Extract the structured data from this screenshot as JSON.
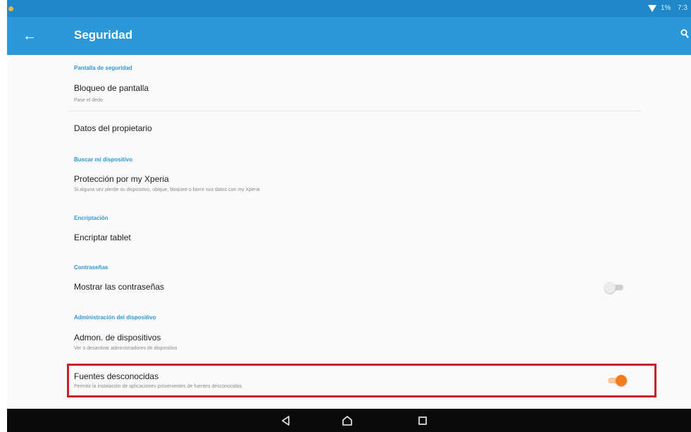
{
  "status_bar": {
    "battery_text": "1%",
    "time": "7:3"
  },
  "app_bar": {
    "title": "Seguridad"
  },
  "sections": {
    "screen_security": {
      "header": "Pantalla de seguridad",
      "lock": {
        "title": "Bloqueo de pantalla",
        "subtitle": "Pase el dedo"
      },
      "owner": {
        "title": "Datos del propietario"
      }
    },
    "find_device": {
      "header": "Buscar mi dispositivo",
      "xperia": {
        "title": "Protección por my Xperia",
        "subtitle": "Si alguna vez pierde su dispositivo, ubique, bloquee o borre sus datos con my Xperia"
      }
    },
    "encryption": {
      "header": "Encriptación",
      "encrypt": {
        "title": "Encriptar tablet"
      }
    },
    "passwords": {
      "header": "Contraseñas",
      "show": {
        "title": "Mostrar las contraseñas",
        "toggle_state": "off"
      }
    },
    "device_admin": {
      "header": "Administración del dispositivo",
      "admins": {
        "title": "Admon. de dispositivos",
        "subtitle": "Ver o desactivar administradores de dispositivo"
      },
      "unknown_sources": {
        "title": "Fuentes desconocidas",
        "subtitle": "Permitir la instalación de aplicaciones provenientes de fuentes desconocidas",
        "toggle_state": "on"
      }
    }
  },
  "colors": {
    "app_bar": "#2b98d8",
    "status_bar": "#1f88c9",
    "accent": "#2b98d8",
    "toggle_on": "#f07c1a",
    "highlight_border": "#c8202a",
    "nav_bar": "#0a0a0a"
  },
  "icons": {
    "back": "arrow-left",
    "search": "magnifier",
    "nav_back": "triangle-left",
    "nav_home": "house",
    "nav_recents": "square"
  }
}
